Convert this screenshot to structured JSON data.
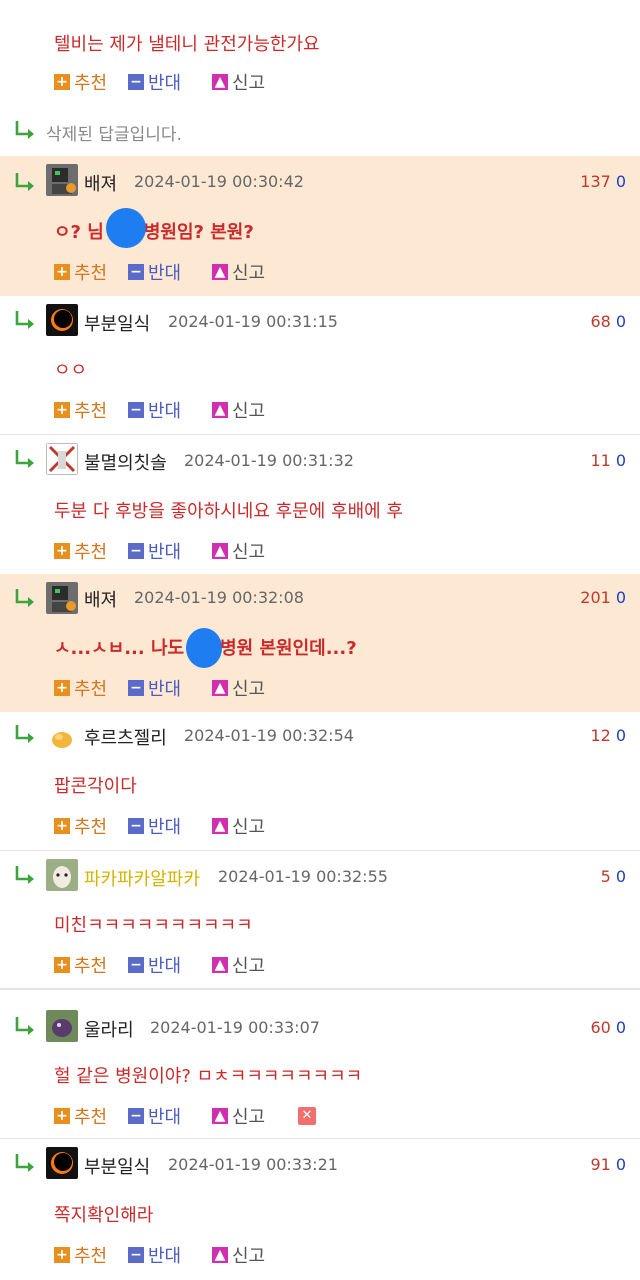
{
  "top_comment": {
    "text": "텔비는 제가 낼테니 관전가능한가요",
    "actions": {
      "recommend": "추천",
      "oppose": "반대",
      "report": "신고"
    }
  },
  "deleted_reply": {
    "text": "삭제된 답글입니다."
  },
  "replies": [
    {
      "nick": "배져",
      "date": "2024-01-19 00:30:42",
      "up": "137",
      "down": "0",
      "text_a": "ㅇ? 님",
      "text_b": "병원임? 본원?",
      "actions": {
        "recommend": "추천",
        "oppose": "반대",
        "report": "신고"
      }
    },
    {
      "nick": "부분일식",
      "date": "2024-01-19 00:31:15",
      "up": "68",
      "down": "0",
      "text": "ㅇㅇ",
      "actions": {
        "recommend": "추천",
        "oppose": "반대",
        "report": "신고"
      }
    },
    {
      "nick": "불멸의칫솔",
      "date": "2024-01-19 00:31:32",
      "up": "11",
      "down": "0",
      "text": "두분 다 후방을 좋아하시네요 후문에 후배에 후",
      "actions": {
        "recommend": "추천",
        "oppose": "반대",
        "report": "신고"
      }
    },
    {
      "nick": "배져",
      "date": "2024-01-19 00:32:08",
      "up": "201",
      "down": "0",
      "text_a": "ㅅ...ㅅㅂ... 나도",
      "text_b": "병원 본원인데...?",
      "actions": {
        "recommend": "추천",
        "oppose": "반대",
        "report": "신고"
      }
    },
    {
      "nick": "후르츠젤리",
      "date": "2024-01-19 00:32:54",
      "up": "12",
      "down": "0",
      "text": "팝콘각이다",
      "actions": {
        "recommend": "추천",
        "oppose": "반대",
        "report": "신고"
      }
    },
    {
      "nick": "파카파카알파카",
      "date": "2024-01-19 00:32:55",
      "up": "5",
      "down": "0",
      "text": "미친ㅋㅋㅋㅋㅋㅋㅋㅋㅋㅋ",
      "actions": {
        "recommend": "추천",
        "oppose": "반대",
        "report": "신고"
      }
    },
    {
      "nick": "울라리",
      "date": "2024-01-19 00:33:07",
      "up": "60",
      "down": "0",
      "text": "헐 같은 병원이야? ㅁㅊㅋㅋㅋㅋㅋㅋㅋㅋ",
      "actions": {
        "recommend": "추천",
        "oppose": "반대",
        "report": "신고"
      }
    },
    {
      "nick": "부분일식",
      "date": "2024-01-19 00:33:21",
      "up": "91",
      "down": "0",
      "text": "쪽지확인해라",
      "actions": {
        "recommend": "추천",
        "oppose": "반대",
        "report": "신고"
      }
    }
  ],
  "colors": {
    "highlight_bg": "#fde8d4",
    "comment_text": "#cc2a2a",
    "recommend": "#d4761a",
    "oppose": "#4a5cc0",
    "upvote": "#c0392b",
    "downvote": "#1f3fbf",
    "nick_special": "#d4b400"
  }
}
